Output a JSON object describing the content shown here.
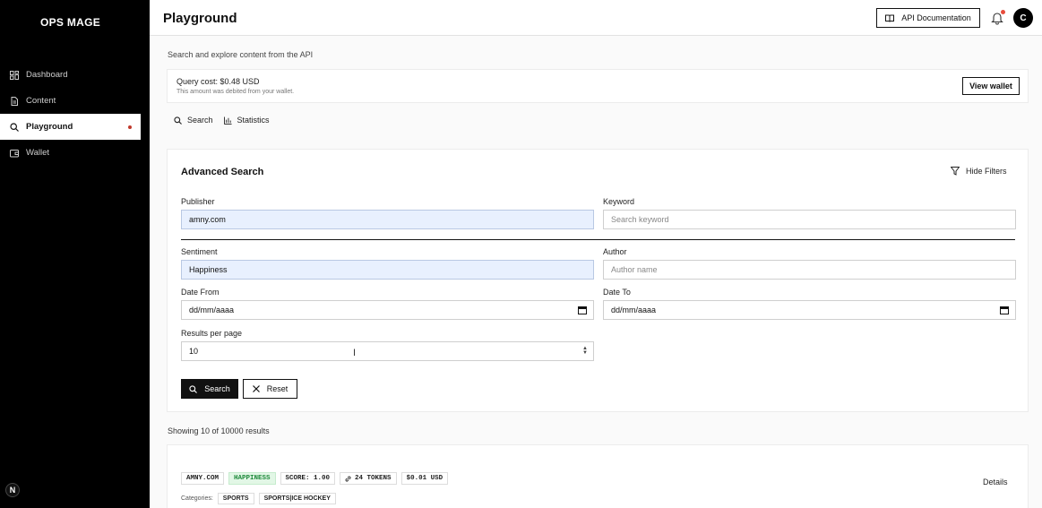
{
  "sidebar": {
    "logo": "OPS MAGE",
    "items": [
      {
        "label": "Dashboard"
      },
      {
        "label": "Content"
      },
      {
        "label": "Playground"
      },
      {
        "label": "Wallet"
      }
    ],
    "badge": "N"
  },
  "header": {
    "title": "Playground",
    "api_docs_label": "API Documentation",
    "avatar_initial": "C"
  },
  "main": {
    "subtitle": "Search and explore content from the API",
    "cost": {
      "title": "Query cost: $0.48 USD",
      "subtitle": "This amount was debited from your wallet.",
      "button": "View wallet"
    },
    "tabs": [
      {
        "label": "Search"
      },
      {
        "label": "Statistics"
      }
    ]
  },
  "search": {
    "title": "Advanced Search",
    "hide_filters": "Hide Filters",
    "publisher": {
      "label": "Publisher",
      "value": "amny.com"
    },
    "keyword": {
      "label": "Keyword",
      "placeholder": "Search keyword"
    },
    "sentiment": {
      "label": "Sentiment",
      "value": "Happiness"
    },
    "author": {
      "label": "Author",
      "placeholder": "Author name"
    },
    "date_from": {
      "label": "Date From",
      "value": "dd/mm/aaaa"
    },
    "date_to": {
      "label": "Date To",
      "value": "dd/mm/aaaa"
    },
    "results_per_page": {
      "label": "Results per page",
      "value": "10"
    },
    "search_button": "Search",
    "reset_button": "Reset"
  },
  "results": {
    "count_text": "Showing 10 of 10000 results",
    "items": [
      {
        "tags": [
          "AMNY.COM",
          "HAPPINESS",
          "SCORE: 1.00",
          "24 TOKENS",
          "$0.01 USD"
        ],
        "details": "Details",
        "categories_label": "Categories:",
        "categories": [
          "SPORTS",
          "SPORTS|ICE HOCKEY"
        ]
      }
    ]
  }
}
